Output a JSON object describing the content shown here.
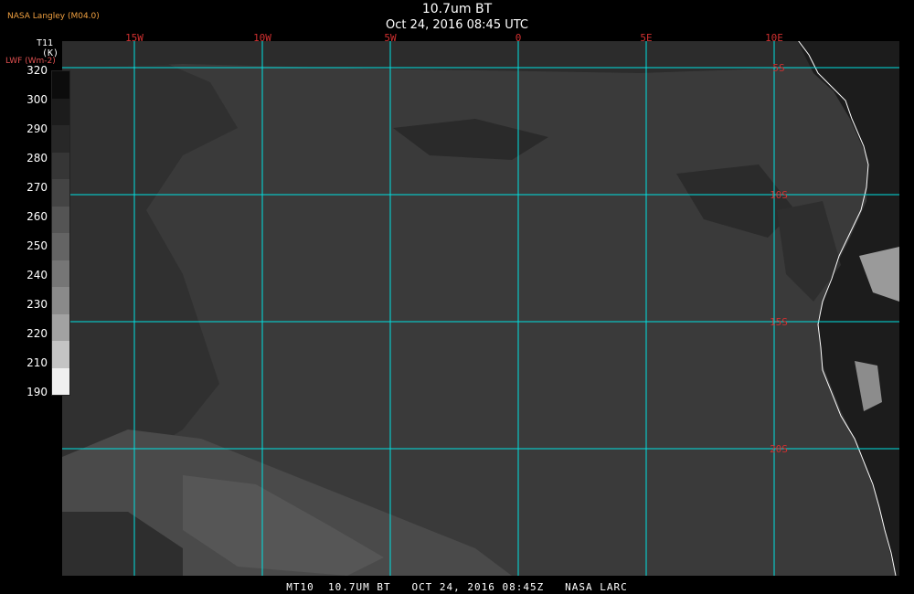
{
  "header": {
    "title": "10.7um BT",
    "subtitle": "Oct 24, 2016 08:45 UTC",
    "source": "NASA Langley (M04.0)"
  },
  "legend": {
    "variable": "T11",
    "unit": "(K)",
    "secondary": "LWF (Wm-2)",
    "ticks": [
      "320",
      "300",
      "290",
      "280",
      "270",
      "260",
      "250",
      "240",
      "230",
      "220",
      "210",
      "190"
    ],
    "colors": [
      "#0c0c0c",
      "#1c1c1c",
      "#282828",
      "#363636",
      "#444444",
      "#545454",
      "#646464",
      "#767676",
      "#8a8a8a",
      "#a2a2a2",
      "#c4c4c4",
      "#f0f0f0"
    ]
  },
  "map": {
    "longitudes": [
      {
        "label": "15W",
        "value": -15
      },
      {
        "label": "10W",
        "value": -10
      },
      {
        "label": "5W",
        "value": -5
      },
      {
        "label": "0",
        "value": 0
      },
      {
        "label": "5E",
        "value": 5
      },
      {
        "label": "10E",
        "value": 10
      }
    ],
    "latitudes": [
      {
        "label": "5S",
        "value": -5
      },
      {
        "label": "10S",
        "value": -10
      },
      {
        "label": "15S",
        "value": -15
      },
      {
        "label": "20S",
        "value": -20
      }
    ],
    "grid_color": "#00e0e0",
    "coast_color": "#ffffff",
    "background_color": "#3a3a3a"
  },
  "footer": {
    "text": "MT10  10.7UM BT   OCT 24, 2016 08:45Z   NASA LARC"
  }
}
